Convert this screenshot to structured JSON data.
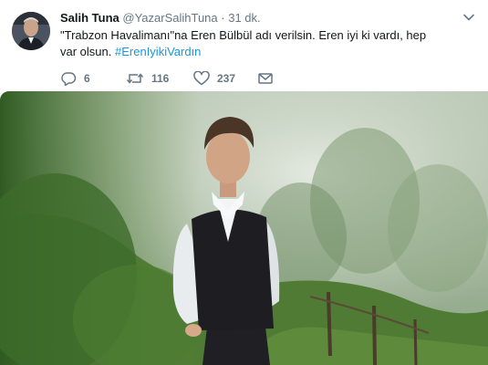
{
  "tweet": {
    "author_name": "Salih Tuna",
    "handle": "@YazarSalihTuna",
    "separator": "·",
    "time": "31 dk.",
    "text": "\"Trabzon Havalimanı\"na Eren Bülbül adı verilsin. Eren iyi ki vardı, hep var olsun.",
    "hashtag": "#ErenIyikiVardın"
  },
  "actions": {
    "reply": {
      "icon": "reply-icon",
      "count": "6"
    },
    "retweet": {
      "icon": "retweet-icon",
      "count": "116"
    },
    "like": {
      "icon": "heart-icon",
      "count": "237"
    },
    "message": {
      "icon": "envelope-icon"
    }
  },
  "colors": {
    "link": "#1b95e0",
    "muted": "#657786",
    "text": "#14171a"
  }
}
